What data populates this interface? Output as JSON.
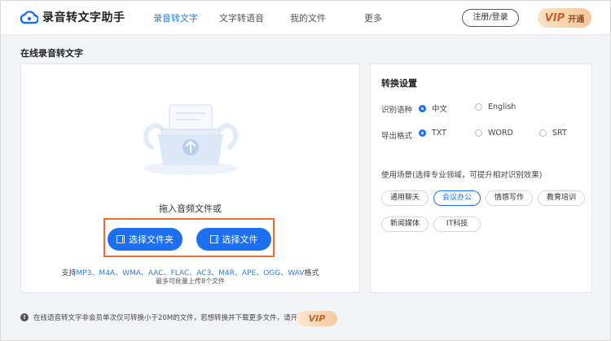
{
  "header": {
    "app_name": "录音转文字助手",
    "nav": [
      "录音转文字",
      "文字转语音",
      "我的文件",
      "更多"
    ],
    "login_label": "注册/登录",
    "vip_label": "VIP",
    "vip_open_label": "开通"
  },
  "page_title": "在线录音转文字",
  "upload": {
    "drop_text": "拖入音频文件或",
    "choose_folder_label": "选择文件夹",
    "choose_file_label": "选择文件",
    "formats_prefix": "支持",
    "formats": "MP3、M4A、WMA、AAC、FLAC、AC3、M4R、APE、OGG、WAV",
    "formats_suffix": "格式",
    "limit_text": "最多可批量上传8个文件"
  },
  "settings": {
    "title": "转换设置",
    "language_label": "识别语种",
    "language_options": [
      "中文",
      "English"
    ],
    "language_selected": "中文",
    "format_label": "导出格式",
    "format_options": [
      "TXT",
      "WORD",
      "SRT"
    ],
    "format_selected": "TXT",
    "scene_label": "使用场景(选择专业领域，可提升相对识别效果)",
    "scenes": [
      "通用聊天",
      "会议办公",
      "情感写作",
      "教育培训",
      "新闻媒体",
      "IT科技"
    ],
    "scene_selected": "会议办公"
  },
  "notice": {
    "text": "在线语音转文字非会员单次仅可转换小于20M的文件，若想转换并下载更多文件，请开通",
    "vip_label": "VIP"
  },
  "colors": {
    "accent": "#1c6ff0",
    "highlight_frame": "#f06a3a",
    "vip_text": "#c0652b"
  }
}
